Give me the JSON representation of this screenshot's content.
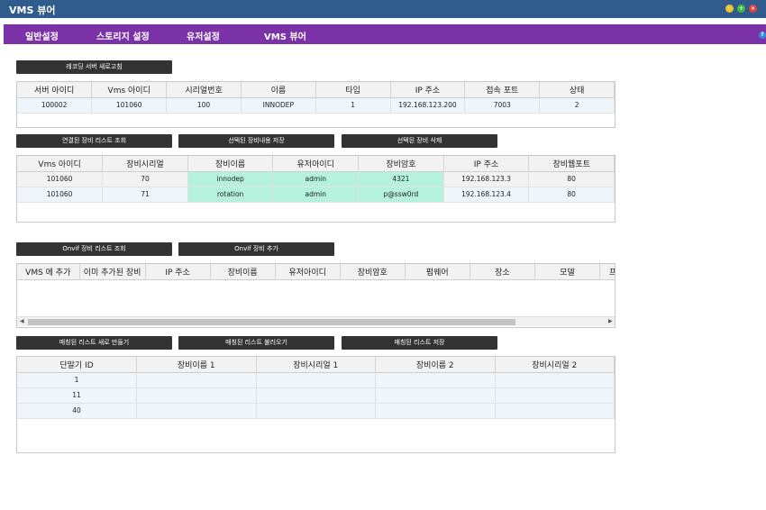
{
  "window": {
    "title": "VMS 뷰어"
  },
  "menu": {
    "items": [
      "일반설정",
      "스토리지 설정",
      "유저설정",
      "VMS 뷰어"
    ],
    "help": "?"
  },
  "server": {
    "refresh_button": "레코딩 서버 새로고침",
    "columns": [
      "서버 아이디",
      "Vms 아이디",
      "시리얼번호",
      "이름",
      "타입",
      "IP 주소",
      "접속 포트",
      "상태"
    ],
    "rows": [
      [
        "100002",
        "101060",
        "100",
        "INNODEP",
        "1",
        "192.168.123.200",
        "7003",
        "2"
      ]
    ]
  },
  "devices": {
    "buttons": {
      "query": "연결된 장비 리스트 조회",
      "save": "선택된 장비내용 저장",
      "delete": "선택된 장비 삭제"
    },
    "columns": [
      "Vms 아이디",
      "장비시리얼",
      "장비이름",
      "유저아이디",
      "장비암호",
      "IP 주소",
      "장비웹포트"
    ],
    "rows": [
      [
        "101060",
        "70",
        "innodep",
        "admin",
        "4321",
        "192.168.123.3",
        "80"
      ],
      [
        "101060",
        "71",
        "rotation",
        "admin",
        "p@ssw0rd",
        "192.168.123.4",
        "80"
      ]
    ]
  },
  "onvif": {
    "buttons": {
      "query": "Onvif 장비 리스트 조회",
      "add": "Onvif 장비 추가"
    },
    "columns": [
      "VMS 에 추가",
      "이미 추가된 장비",
      "IP 주소",
      "장비이름",
      "유저아이디",
      "장비암호",
      "펌웨어",
      "장소",
      "모델",
      "프"
    ]
  },
  "matching": {
    "buttons": {
      "create": "매칭된 리스트 새로 만들기",
      "load": "매칭된 리스트 불러오기",
      "save": "매칭된 리스트 저장"
    },
    "columns": [
      "단말기 ID",
      "장비이름 1",
      "장비시리얼 1",
      "장비이름 2",
      "장비시리얼 2"
    ],
    "rows": [
      [
        "1",
        "",
        "",
        "",
        ""
      ],
      [
        "11",
        "",
        "",
        "",
        ""
      ],
      [
        "40",
        "",
        "",
        "",
        ""
      ]
    ]
  },
  "colors": {
    "titlebar": "#2f5c8c",
    "menubar": "#7b32a8",
    "button": "#333333",
    "highlight": "#b5f2dd",
    "row_alt": "#eef6fb"
  }
}
